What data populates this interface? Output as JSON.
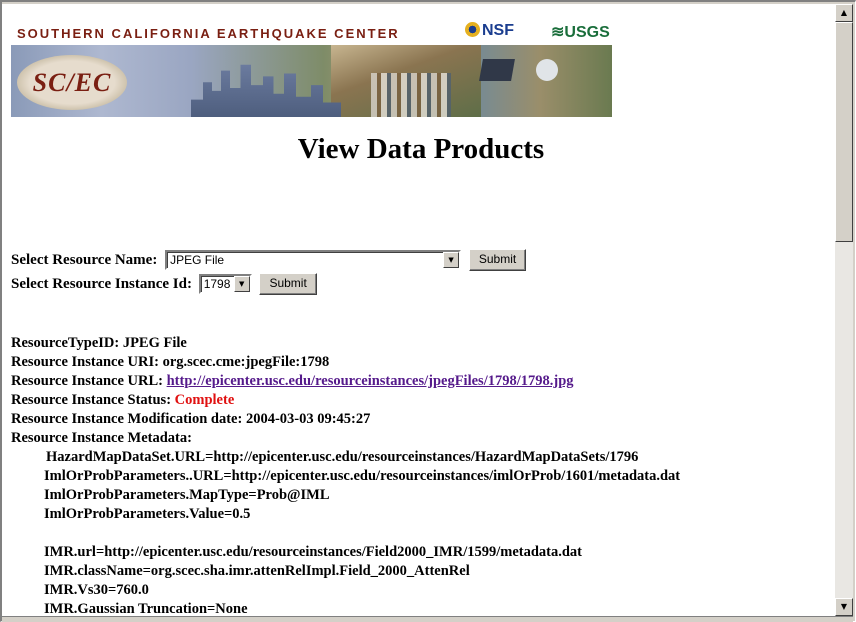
{
  "banner": {
    "org_name": "SOUTHERN CALIFORNIA EARTHQUAKE CENTER",
    "nsf": "NSF",
    "usgs": "USGS",
    "logo": "SC/EC"
  },
  "page_title": "View Data Products",
  "form": {
    "resource_name_label": "Select Resource Name:",
    "resource_name_value": "JPEG File",
    "submit1": "Submit",
    "instance_id_label": "Select Resource Instance Id:",
    "instance_id_value": "1798",
    "submit2": "Submit"
  },
  "info": {
    "type_label": "ResourceTypeID:",
    "type_value": "JPEG File",
    "uri_label": "Resource Instance URI:",
    "uri_value": "org.scec.cme:jpegFile:1798",
    "url_label": "Resource Instance URL:",
    "url_value": "http://epicenter.usc.edu/resourceinstances/jpegFiles/1798/1798.jpg",
    "status_label": "Resource Instance Status:",
    "status_value": "Complete",
    "moddate_label": "Resource Instance Modification date:",
    "moddate_value": "2004-03-03 09:45:27",
    "metadata_label": "Resource Instance Metadata:"
  },
  "metadata_lines": [
    "HazardMapDataSet.URL=http://epicenter.usc.edu/resourceinstances/HazardMapDataSets/1796",
    "ImlOrProbParameters..URL=http://epicenter.usc.edu/resourceinstances/imlOrProb/1601/metadata.dat",
    "ImlOrProbParameters.MapType=Prob@IML",
    "ImlOrProbParameters.Value=0.5",
    "",
    "IMR.url=http://epicenter.usc.edu/resourceinstances/Field2000_IMR/1599/metadata.dat",
    "IMR.className=org.scec.sha.imr.attenRelImpl.Field_2000_AttenRel",
    "IMR.Vs30=760.0",
    "IMR.Gaussian Truncation=None"
  ],
  "colors": {
    "status_complete": "#e01010",
    "link_visited": "#551a8b",
    "window_face": "#d4d0c8"
  }
}
